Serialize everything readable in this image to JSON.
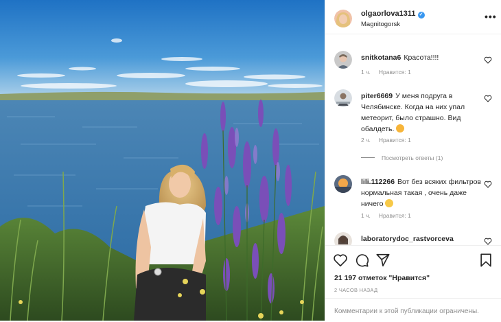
{
  "header": {
    "username": "olgaorlova1311",
    "location": "Magnitogorsk",
    "verified_icon": "verified-badge-icon",
    "more_icon": "more-options-icon"
  },
  "comments": [
    {
      "username": "snitkotana6",
      "text": "Красота!!!!",
      "time": "1 ч.",
      "likes": "Нравится: 1"
    },
    {
      "username": "piter6669",
      "text": "У меня подруга в Челябинске. Когда на них упал метеорит, было страшно. Вид обалдеть.",
      "emoji": "star-struck-emoji",
      "time": "2 ч.",
      "likes": "Нравится: 1",
      "replies": "Посмотреть ответы (1)"
    },
    {
      "username": "lili.112266",
      "text": "Вот без всяких фильтров нормальная такая , очень даже ничего",
      "emoji": "smiling-emoji",
      "time": "1 ч.",
      "likes": "Нравится: 1"
    },
    {
      "username": "laboratorydoc_rastvorceva",
      "text": ""
    }
  ],
  "actions": {
    "likes": "21 197 отметок \"Нравится\"",
    "posted": "2 ЧАСОВ НАЗАД",
    "comments_limited": "Комментарии к этой публикации ограничены."
  },
  "colors": {
    "sky_top": "#1f79c9",
    "water": "#3d7bb0",
    "flowers": "#7a4fb8",
    "verified": "#3897f0"
  }
}
